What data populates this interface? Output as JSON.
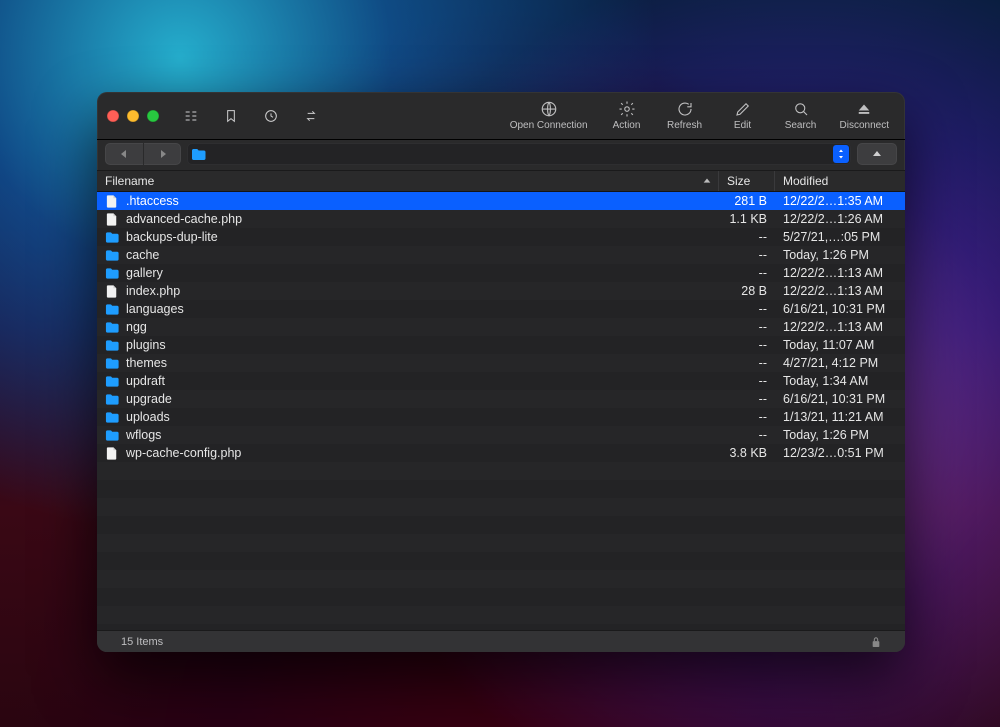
{
  "toolbar": {
    "open_connection": "Open Connection",
    "action": "Action",
    "refresh": "Refresh",
    "edit": "Edit",
    "search": "Search",
    "disconnect": "Disconnect"
  },
  "columns": {
    "filename": "Filename",
    "size": "Size",
    "modified": "Modified"
  },
  "files": [
    {
      "name": ".htaccess",
      "type": "file",
      "size": "281 B",
      "modified": "12/22/2…1:35 AM",
      "selected": true
    },
    {
      "name": "advanced-cache.php",
      "type": "file",
      "size": "1.1 KB",
      "modified": "12/22/2…1:26 AM"
    },
    {
      "name": "backups-dup-lite",
      "type": "folder",
      "size": "--",
      "modified": "5/27/21,…:05 PM"
    },
    {
      "name": "cache",
      "type": "folder",
      "size": "--",
      "modified": "Today, 1:26 PM"
    },
    {
      "name": "gallery",
      "type": "folder",
      "size": "--",
      "modified": "12/22/2…1:13 AM"
    },
    {
      "name": "index.php",
      "type": "file",
      "size": "28 B",
      "modified": "12/22/2…1:13 AM"
    },
    {
      "name": "languages",
      "type": "folder",
      "size": "--",
      "modified": "6/16/21, 10:31 PM"
    },
    {
      "name": "ngg",
      "type": "folder",
      "size": "--",
      "modified": "12/22/2…1:13 AM"
    },
    {
      "name": "plugins",
      "type": "folder",
      "size": "--",
      "modified": "Today, 11:07 AM"
    },
    {
      "name": "themes",
      "type": "folder",
      "size": "--",
      "modified": "4/27/21, 4:12 PM"
    },
    {
      "name": "updraft",
      "type": "folder",
      "size": "--",
      "modified": "Today, 1:34 AM"
    },
    {
      "name": "upgrade",
      "type": "folder",
      "size": "--",
      "modified": "6/16/21, 10:31 PM"
    },
    {
      "name": "uploads",
      "type": "folder",
      "size": "--",
      "modified": "1/13/21, 11:21 AM"
    },
    {
      "name": "wflogs",
      "type": "folder",
      "size": "--",
      "modified": "Today, 1:26 PM"
    },
    {
      "name": "wp-cache-config.php",
      "type": "file",
      "size": "3.8 KB",
      "modified": "12/23/2…0:51 PM"
    }
  ],
  "status": {
    "items": "15 Items"
  }
}
